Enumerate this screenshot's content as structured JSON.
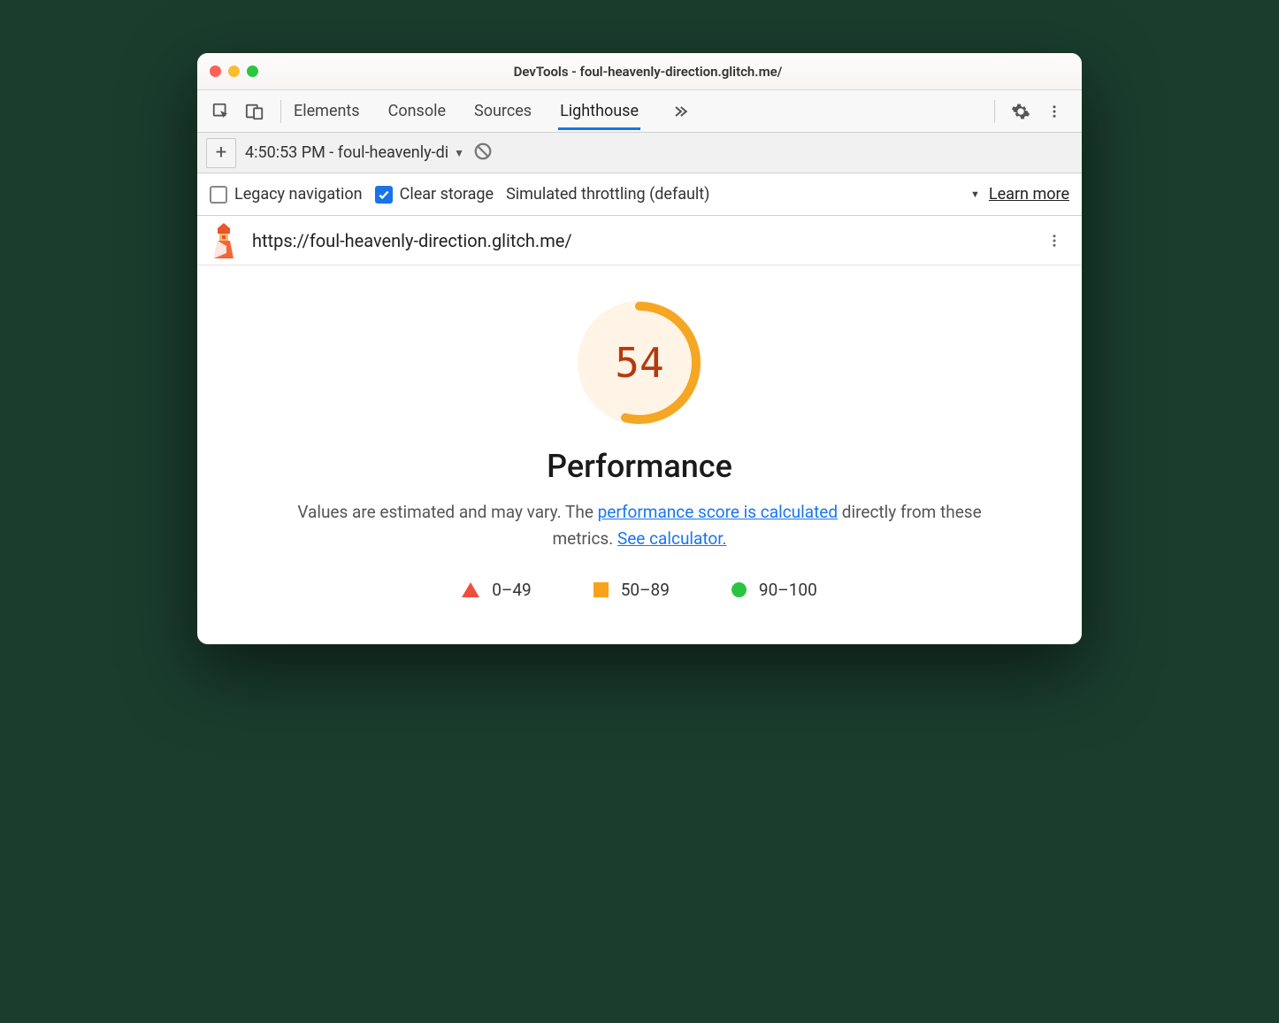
{
  "window": {
    "title": "DevTools - foul-heavenly-direction.glitch.me/"
  },
  "tabs": {
    "items": [
      "Elements",
      "Console",
      "Sources",
      "Lighthouse"
    ],
    "active": "Lighthouse"
  },
  "subbar": {
    "report_label": "4:50:53 PM - foul-heavenly-di"
  },
  "options": {
    "legacy_label": "Legacy navigation",
    "legacy_checked": false,
    "clear_label": "Clear storage",
    "clear_checked": true,
    "throttling": "Simulated throttling (default)",
    "learn_more": "Learn more"
  },
  "url": "https://foul-heavenly-direction.glitch.me/",
  "report": {
    "score": "54",
    "score_value": 54,
    "title": "Performance",
    "desc_pre": "Values are estimated and may vary. The ",
    "link1": "performance score is calculated",
    "desc_mid": " directly from these metrics. ",
    "link2": "See calculator.",
    "legend": {
      "r1": "0–49",
      "r2": "50–89",
      "r3": "90–100"
    }
  },
  "chart_data": {
    "type": "pie",
    "title": "Performance",
    "values": [
      54
    ],
    "categories": [
      "Performance score"
    ],
    "ylim": [
      0,
      100
    ]
  }
}
